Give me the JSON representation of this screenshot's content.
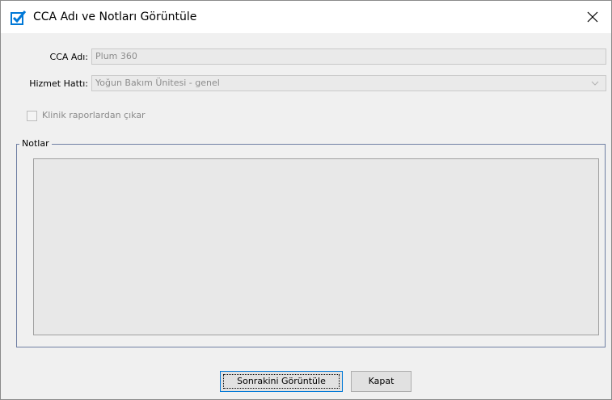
{
  "window": {
    "title": "CCA Adı ve Notları Görüntüle",
    "icon": "checkbox-check-icon",
    "close_icon": "close-icon"
  },
  "form": {
    "cca_label": "CCA Adı:",
    "cca_value": "Plum 360",
    "service_label": "Hizmet Hattı:",
    "service_value": "Yoğun Bakım Ünitesi - genel",
    "exclude_label": "Klinik raporlardan çıkar",
    "exclude_checked": false
  },
  "notes": {
    "legend": "Notlar",
    "text": ""
  },
  "buttons": {
    "next_label": "Sonrakini Görüntüle",
    "close_label": "Kapat"
  },
  "colors": {
    "accent": "#0078d7",
    "group_border": "#6f7fa3"
  }
}
